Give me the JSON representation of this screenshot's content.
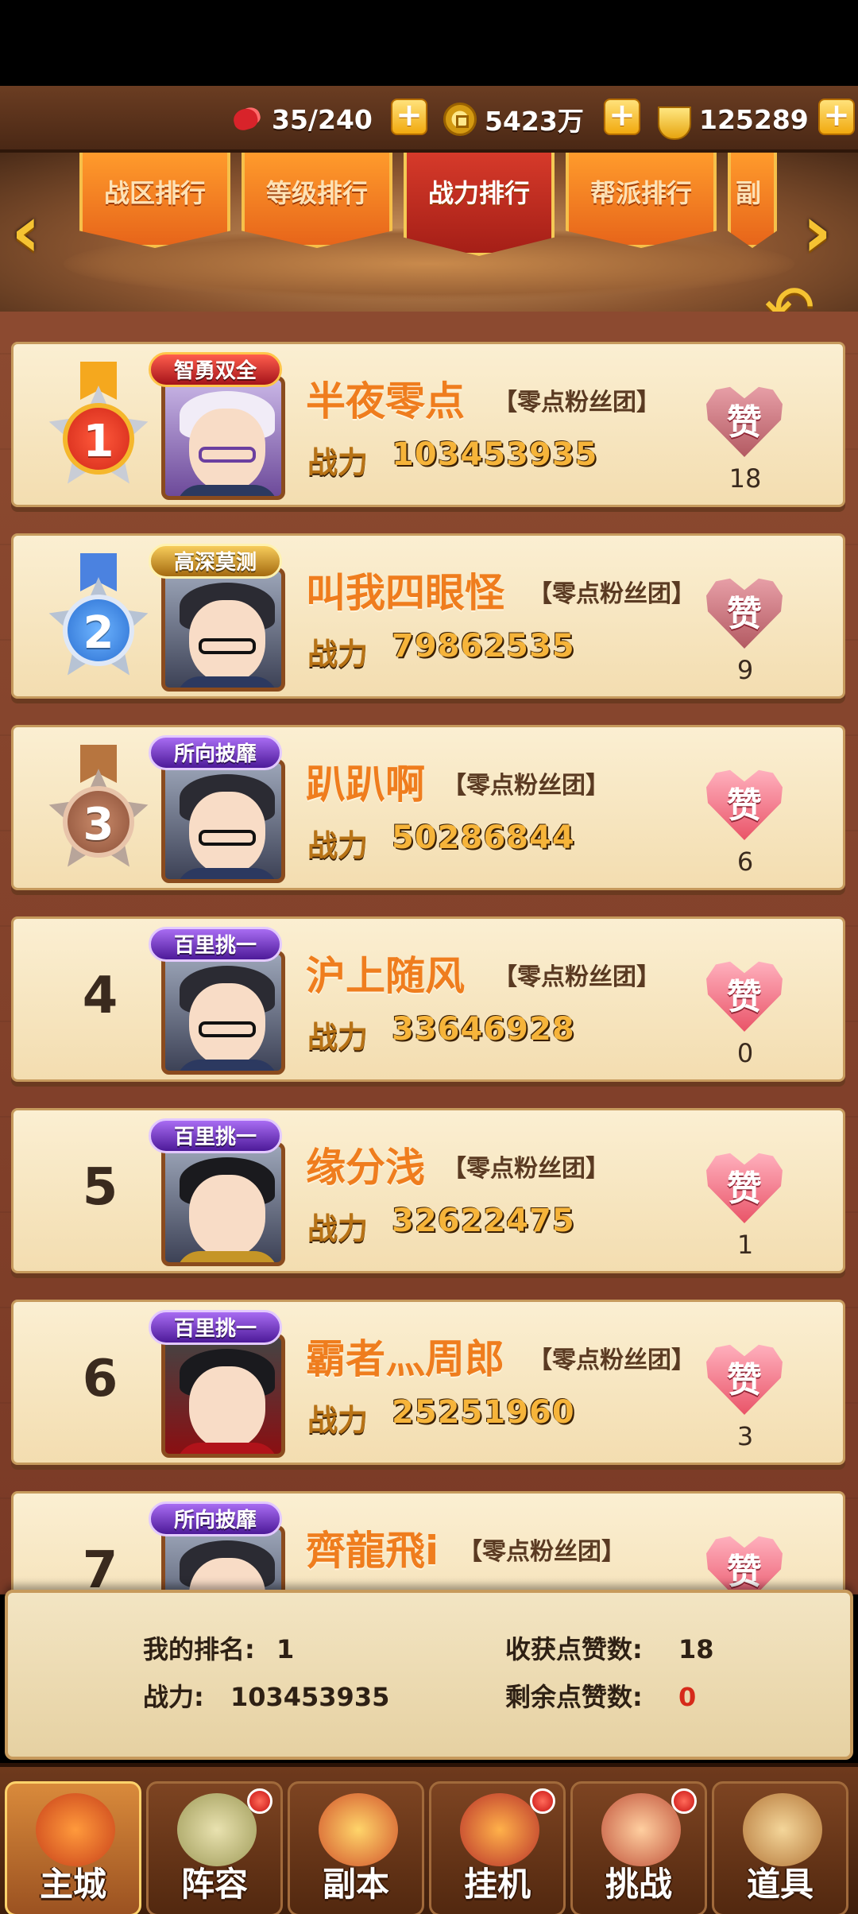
{
  "resources": {
    "stamina": "35/240",
    "coins": "5423万",
    "ingots": "125289"
  },
  "tabs": [
    {
      "label": "战区排行",
      "active": false
    },
    {
      "label": "等级排行",
      "active": false
    },
    {
      "label": "战力排行",
      "active": true
    },
    {
      "label": "帮派排行",
      "active": false
    },
    {
      "label": "副",
      "active": false
    }
  ],
  "power_label": "战力",
  "like_glyph": "赞",
  "rows": [
    {
      "rank": "1",
      "title": "智勇双全",
      "name": "半夜零点",
      "guild": "【零点粉丝团】",
      "power": "103453935",
      "likes": "18"
    },
    {
      "rank": "2",
      "title": "高深莫测",
      "name": "叫我四眼怪",
      "guild": "【零点粉丝团】",
      "power": "79862535",
      "likes": "9"
    },
    {
      "rank": "3",
      "title": "所向披靡",
      "name": "趴趴啊",
      "guild": "【零点粉丝团】",
      "power": "50286844",
      "likes": "6"
    },
    {
      "rank": "4",
      "title": "百里挑一",
      "name": "沪上随风",
      "guild": "【零点粉丝团】",
      "power": "33646928",
      "likes": "0"
    },
    {
      "rank": "5",
      "title": "百里挑一",
      "name": "缘分浅",
      "guild": "【零点粉丝团】",
      "power": "32622475",
      "likes": "1"
    },
    {
      "rank": "6",
      "title": "百里挑一",
      "name": "霸者灬周郎",
      "guild": "【零点粉丝团】",
      "power": "25251960",
      "likes": "3"
    },
    {
      "rank": "7",
      "title": "所向披靡",
      "name": "齊龍飛i",
      "guild": "【零点粉丝团】",
      "power": "",
      "likes": ""
    }
  ],
  "my_rank": {
    "rank_label": "我的排名:",
    "rank_value": "1",
    "power_label": "战力:",
    "power_value": "103453935",
    "received_label": "收获点赞数:",
    "received_value": "18",
    "remaining_label": "剩余点赞数:",
    "remaining_value": "0"
  },
  "nav": [
    {
      "label": "主城",
      "icon": "castle-icon"
    },
    {
      "label": "阵容",
      "icon": "formation-icon"
    },
    {
      "label": "副本",
      "icon": "dungeon-icon"
    },
    {
      "label": "挂机",
      "icon": "idle-icon"
    },
    {
      "label": "挑战",
      "icon": "challenge-icon"
    },
    {
      "label": "道具",
      "icon": "items-icon"
    }
  ],
  "colors": {
    "name": "#ef7d1e",
    "power": "#f6b43a",
    "accent_red": "#d62a1a"
  }
}
